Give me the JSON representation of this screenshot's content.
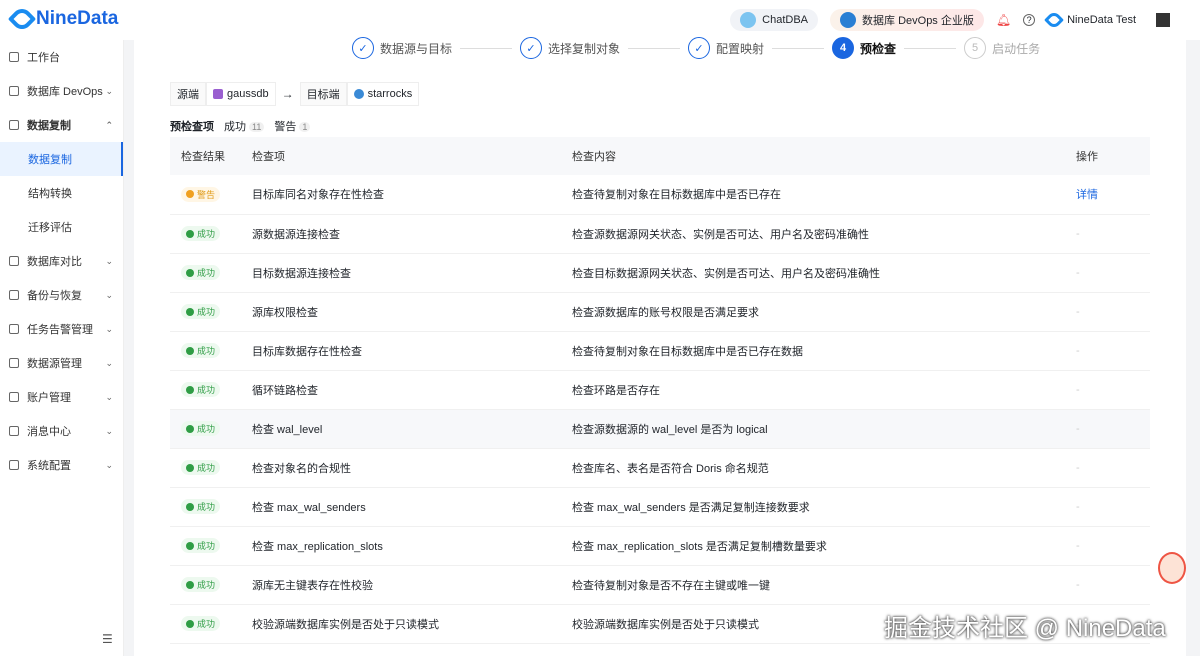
{
  "header": {
    "brand": "NineData",
    "chatdba": "ChatDBA",
    "edition": "数据库 DevOps 企业版",
    "user": "NineData Test"
  },
  "sidebar": {
    "items": [
      {
        "label": "工作台"
      },
      {
        "label": "数据库 DevOps"
      },
      {
        "label": "数据复制"
      },
      {
        "label": "数据库对比"
      },
      {
        "label": "备份与恢复"
      },
      {
        "label": "任务告警管理"
      },
      {
        "label": "数据源管理"
      },
      {
        "label": "账户管理"
      },
      {
        "label": "消息中心"
      },
      {
        "label": "系统配置"
      }
    ],
    "sub": [
      "数据复制",
      "结构转换",
      "迁移评估"
    ]
  },
  "steps": [
    {
      "num": "1",
      "label": "数据源与目标"
    },
    {
      "num": "2",
      "label": "选择复制对象"
    },
    {
      "num": "3",
      "label": "配置映射"
    },
    {
      "num": "4",
      "label": "预检查"
    },
    {
      "num": "5",
      "label": "启动任务"
    }
  ],
  "route": {
    "source_label": "源端",
    "source": "gaussdb",
    "arrow": "→",
    "target_label": "目标端",
    "target": "starrocks"
  },
  "summary": {
    "title": "预检查项",
    "success_label": "成功",
    "success_count": "11",
    "warn_label": "警告",
    "warn_count": "1"
  },
  "table": {
    "headers": [
      "检查结果",
      "检查项",
      "检查内容",
      "操作"
    ],
    "rows": [
      {
        "status": "警告",
        "item": "目标库同名对象存在性检查",
        "content": "检查待复制对象在目标数据库中是否已存在",
        "action": "详情"
      },
      {
        "status": "成功",
        "item": "源数据源连接检查",
        "content": "检查源数据源网关状态、实例是否可达、用户名及密码准确性",
        "action": "-"
      },
      {
        "status": "成功",
        "item": "目标数据源连接检查",
        "content": "检查目标数据源网关状态、实例是否可达、用户名及密码准确性",
        "action": "-"
      },
      {
        "status": "成功",
        "item": "源库权限检查",
        "content": "检查源数据库的账号权限是否满足要求",
        "action": "-"
      },
      {
        "status": "成功",
        "item": "目标库数据存在性检查",
        "content": "检查待复制对象在目标数据库中是否已存在数据",
        "action": "-"
      },
      {
        "status": "成功",
        "item": "循环链路检查",
        "content": "检查环路是否存在",
        "action": "-"
      },
      {
        "status": "成功",
        "item": "检查 wal_level",
        "content": "检查源数据源的 wal_level 是否为 logical",
        "action": "-"
      },
      {
        "status": "成功",
        "item": "检查对象名的合规性",
        "content": "检查库名、表名是否符合 Doris 命名规范",
        "action": "-"
      },
      {
        "status": "成功",
        "item": "检查 max_wal_senders",
        "content": "检查 max_wal_senders 是否满足复制连接数要求",
        "action": "-"
      },
      {
        "status": "成功",
        "item": "检查 max_replication_slots",
        "content": "检查 max_replication_slots 是否满足复制槽数量要求",
        "action": "-"
      },
      {
        "status": "成功",
        "item": "源库无主键表存在性校验",
        "content": "检查待复制对象是否不存在主键或唯一键",
        "action": "-"
      },
      {
        "status": "成功",
        "item": "校验源端数据库实例是否处于只读模式",
        "content": "校验源端数据库实例是否处于只读模式",
        "action": "-"
      }
    ]
  },
  "watermark": "掘金技术社区 @ NineData"
}
